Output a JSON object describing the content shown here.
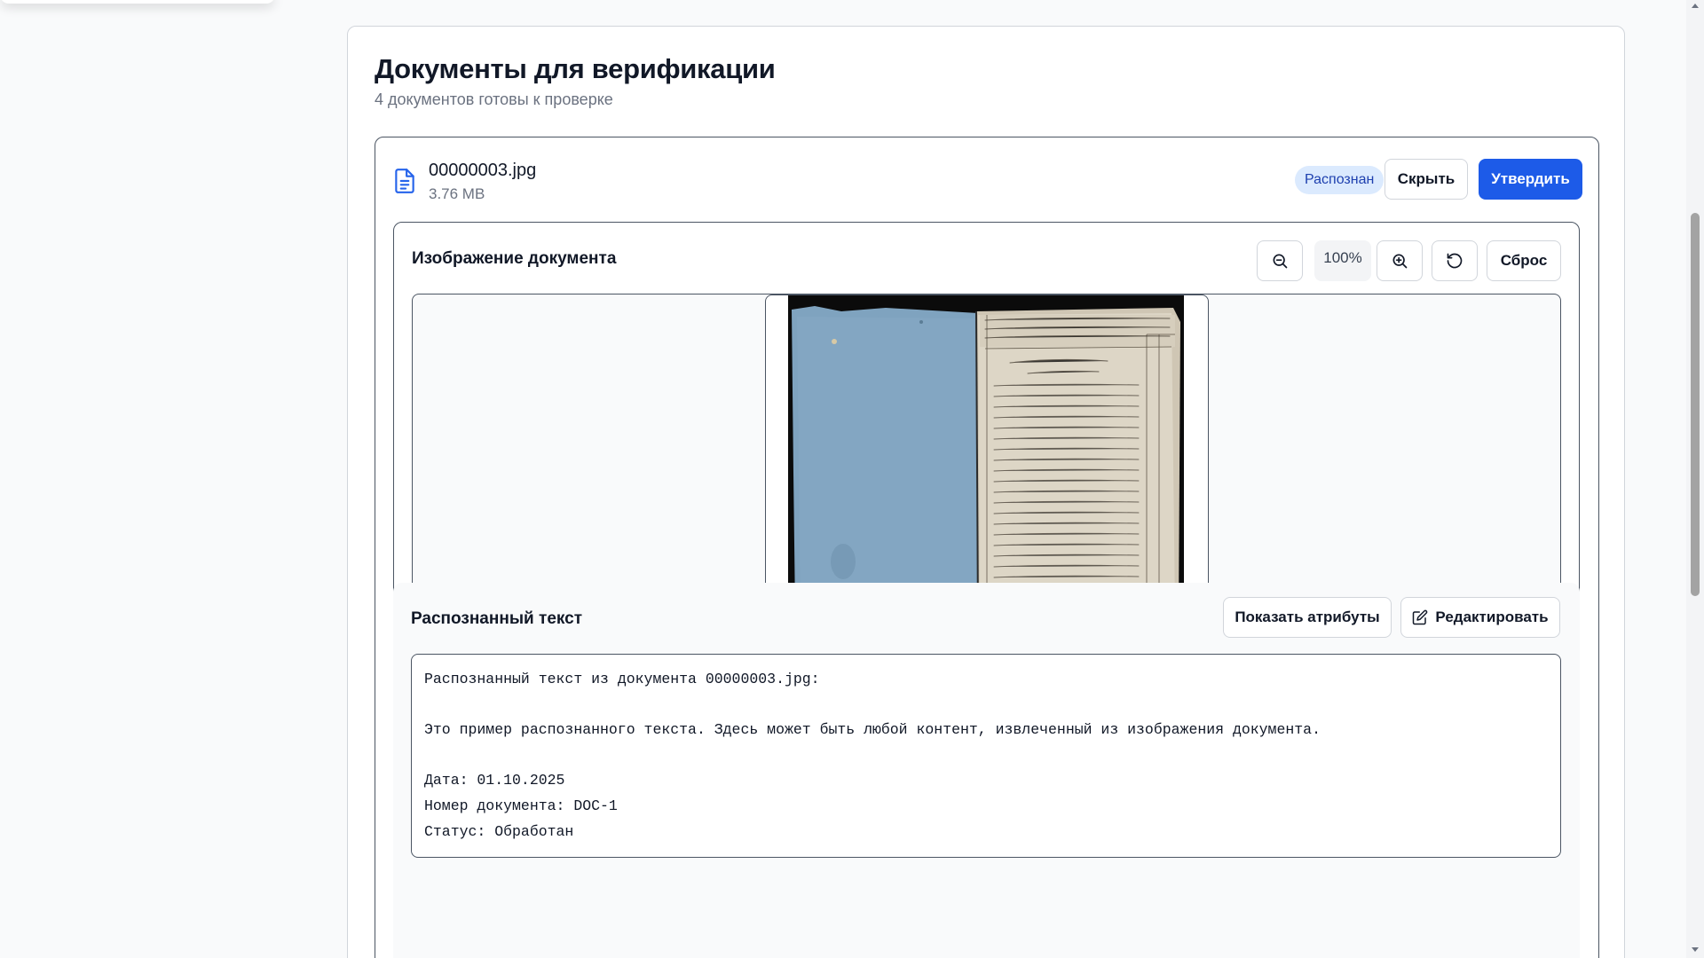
{
  "page": {
    "title": "Документы для верификации",
    "subtitle": "4 документов готовы к проверке"
  },
  "document": {
    "file_name": "00000003.jpg",
    "file_size": "3.76 MB",
    "status_badge": "Распознан",
    "hide_label": "Скрыть",
    "approve_label": "Утвердить"
  },
  "image_section": {
    "title": "Изображение документа",
    "zoom_level": "100%",
    "reset_label": "Сброс",
    "icons": [
      "zoom-out-icon",
      "zoom-in-icon",
      "rotate-icon"
    ]
  },
  "text_section": {
    "title": "Распознанный текст",
    "show_attributes_label": "Показать атрибуты",
    "edit_label": "Редактировать",
    "content": "Распознанный текст из документа 00000003.jpg:\n\nЭто пример распознанного текста. Здесь может быть любой контент, извлеченный из изображения документа.\n\nДата: 01.10.2025\nНомер документа: DOC-1\nСтатус: Обработан"
  },
  "colors": {
    "accent": "#1d5be8",
    "badge_bg": "#dbeafe",
    "badge_text": "#1e40af"
  }
}
